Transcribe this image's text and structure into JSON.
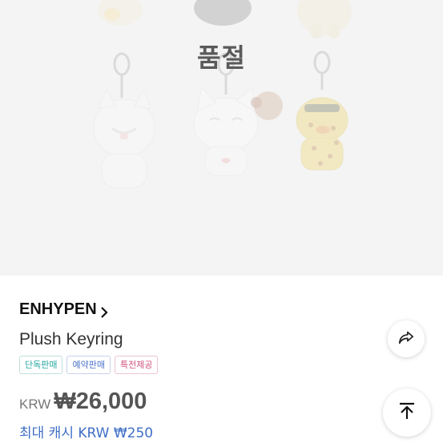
{
  "product_image": {
    "status_label": "품절",
    "alt": ""
  },
  "product": {
    "artist": "ENHYPEN",
    "name": "Plush Keyring",
    "badges": [
      "단독판매",
      "예약판매",
      "특전제공"
    ],
    "currency": "KRW",
    "price": "₩26,000",
    "cashback": "최대 캐시 KRW ₩250"
  },
  "icons": {
    "artist_arrow": "chevron-right-icon",
    "share": "share-icon",
    "scroll_top": "arrow-up-to-top-icon"
  }
}
